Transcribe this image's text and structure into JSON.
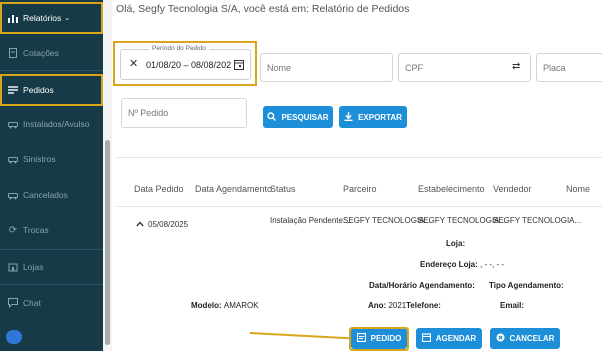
{
  "header": {
    "greeting": "Olá, Segfy Tecnologia S/A, você está em: Relatório de Pedidos"
  },
  "sidebar": {
    "items": [
      {
        "label": "Relatórios",
        "icon": "bar-chart-icon"
      },
      {
        "label": "Cotações",
        "icon": "document-icon"
      },
      {
        "label": "Pedidos",
        "icon": "list-icon"
      },
      {
        "label": "Instalados/Avulso",
        "icon": "car-icon"
      },
      {
        "label": "Sinistros",
        "icon": "car-icon"
      },
      {
        "label": "Cancelados",
        "icon": "car-icon"
      },
      {
        "label": "Trocas",
        "icon": "refresh-icon"
      },
      {
        "label": "Lojas",
        "icon": "store-icon"
      },
      {
        "label": "Chat",
        "icon": "chat-icon"
      }
    ]
  },
  "filters": {
    "period_legend": "Período do Pedido",
    "period_value": "01/08/20 – 08/08/202",
    "nome_placeholder": "Nome",
    "cpf_placeholder": "CPF",
    "placa_placeholder": "Placa",
    "pedido_placeholder": "Nº Pedido",
    "search_label": "PESQUISAR",
    "export_label": "EXPORTAR"
  },
  "table": {
    "headers": [
      "Data Pedido",
      "Data Agendamento",
      "Status",
      "Parceiro",
      "Estabelecimento",
      "Vendedor",
      "Nome"
    ],
    "row": {
      "data_pedido": "05/08/2025",
      "status": "Instalação Pendente...",
      "parceiro": "SEGFY TECNOLOGIA...",
      "estabelecimento": "SEGFY TECNOLOGIA...",
      "vendedor": "SEGFY TECNOLOGIA..."
    },
    "details": {
      "loja_label": "Loja:",
      "endereco_label": "Endereço Loja:",
      "endereco_value": ", - -, - -",
      "data_hora_label": "Data/Horário Agendamento:",
      "tipo_label": "Tipo Agendamento:",
      "modelo_label": "Modelo:",
      "modelo_value": "AMAROK",
      "ano_label": "Ano:",
      "ano_value": "2021",
      "telefone_label": "Telefone:",
      "email_label": "Email:"
    },
    "actions": {
      "pedido": "PEDIDO",
      "agendar": "AGENDAR",
      "cancelar": "CANCELAR"
    }
  }
}
